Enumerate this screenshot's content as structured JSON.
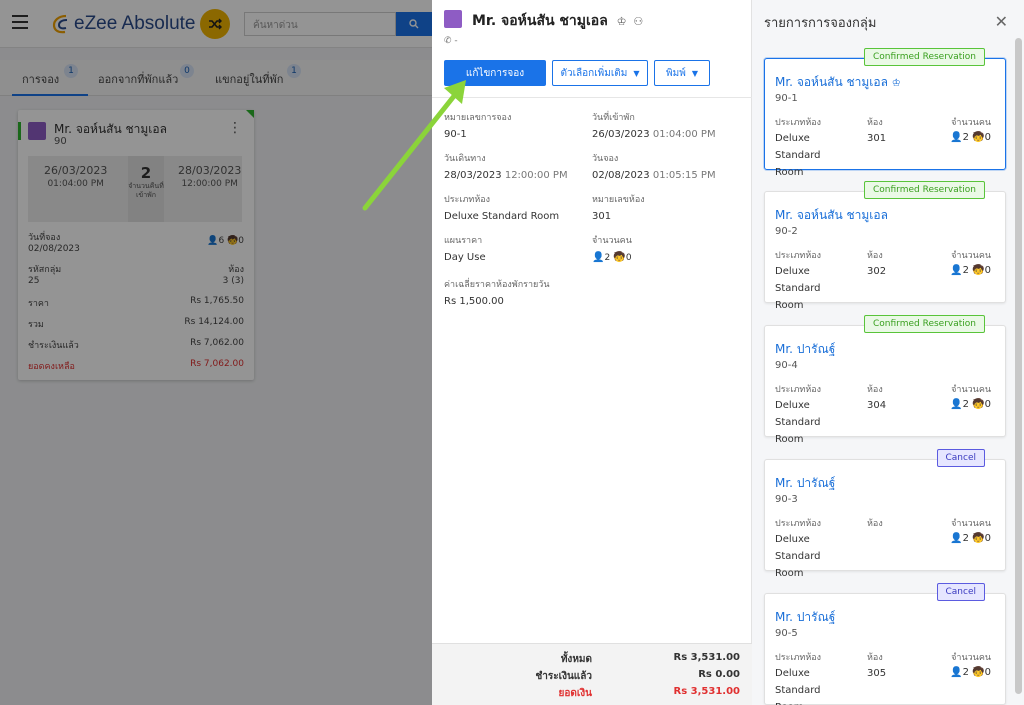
{
  "app": {
    "logo_text": "eZee Absolute",
    "search_placeholder": "ค้นหาด่วน"
  },
  "tabs": [
    {
      "label": "การจอง",
      "count": "1"
    },
    {
      "label": "ออกจากที่พักแล้ว",
      "count": "0"
    },
    {
      "label": "แขกอยู่ในที่พัก",
      "count": "1"
    }
  ],
  "res_card": {
    "guest": "Mr. จอห์นสัน ชามูเอล",
    "number": "90",
    "arrival_date": "26/03/2023",
    "arrival_time": "01:04:00 PM",
    "departure_date": "28/03/2023",
    "departure_time": "12:00:00 PM",
    "nights": "2",
    "nights_label": "จำนวนคืนที่เข้าพัก",
    "booking_label": "วันที่จอง",
    "booking_date": "02/08/2023",
    "adults": "6",
    "children": "0",
    "group_label": "รหัสกลุ่ม",
    "group_value": "25",
    "room_label": "ห้อง",
    "room_value": "3 (3)",
    "price_label": "ราคา",
    "price_value": "Rs 1,765.50",
    "total_label": "รวม",
    "total_value": "Rs 14,124.00",
    "paid_label": "ชำระเงินแล้ว",
    "paid_value": "Rs 7,062.00",
    "balance_label": "ยอดคงเหลือ",
    "balance_value": "Rs 7,062.00"
  },
  "detail": {
    "guest": "Mr. จอห์นสัน ชามูเอล",
    "phone": "-",
    "edit_button": "แก้ไขการจอง",
    "more_button": "ตัวเลือกเพิ่มเติม",
    "print_button": "พิมพ์",
    "res_no_label": "หมายเลขการจอง",
    "res_no": "90-1",
    "checkin_label": "วันที่เข้าพัก",
    "checkin_date": "26/03/2023",
    "checkin_time": "01:04:00 PM",
    "departure_label": "วันเดินทาง",
    "departure_date": "28/03/2023",
    "departure_time": "12:00:00 PM",
    "booking_label": "วันจอง",
    "booking_date": "02/08/2023",
    "booking_time": "01:05:15 PM",
    "room_type_label": "ประเภทห้อง",
    "room_type": "Deluxe Standard Room",
    "room_no_label": "หมายเลขห้อง",
    "room_no": "301",
    "rate_plan_label": "แผนราคา",
    "rate_plan": "Day Use",
    "pax_label": "จำนวนคน",
    "adults": "2",
    "children": "0",
    "avg_rate_label": "ค่าเฉลี่ยราคาห้องพักรายวัน",
    "avg_rate": "Rs 1,500.00",
    "total_label": "ทั้งหมด",
    "total": "Rs 3,531.00",
    "paid_label": "ชำระเงินแล้ว",
    "paid": "Rs 0.00",
    "balance_label": "ยอดเงิน",
    "balance": "Rs 3,531.00"
  },
  "group_list": {
    "title": "รายการการจองกลุ่ม",
    "room_type_label": "ประเภทห้อง",
    "room_label": "ห้อง",
    "pax_label": "จำนวนคน",
    "items": [
      {
        "status": "Confirmed Reservation",
        "guest": "Mr. จอห์นสัน ชามูเอล",
        "number": "90-1",
        "room_type_1": "Deluxe Standard",
        "room_type_2": "Room",
        "room": "301",
        "adults": "2",
        "children": "0"
      },
      {
        "status": "Confirmed Reservation",
        "guest": "Mr. จอห์นสัน ชามูเอล",
        "number": "90-2",
        "room_type_1": "Deluxe Standard",
        "room_type_2": "Room",
        "room": "302",
        "adults": "2",
        "children": "0"
      },
      {
        "status": "Confirmed Reservation",
        "guest": "Mr. ปารัณฐ์",
        "number": "90-4",
        "room_type_1": "Deluxe Standard",
        "room_type_2": "Room",
        "room": "304",
        "adults": "2",
        "children": "0"
      },
      {
        "status": "Cancel",
        "guest": "Mr. ปารัณฐ์",
        "number": "90-3",
        "room_type_1": "Deluxe Standard",
        "room_type_2": "Room",
        "room": "",
        "adults": "2",
        "children": "0"
      },
      {
        "status": "Cancel",
        "guest": "Mr. ปารัณฐ์",
        "number": "90-5",
        "room_type_1": "Deluxe Standard",
        "room_type_2": "Room",
        "room": "305",
        "adults": "2",
        "children": "0"
      }
    ]
  },
  "colors": {
    "primary": "#1a73e8",
    "confirmed": "#59c43a",
    "cancel": "#5b5be0",
    "balance_red": "#e03030",
    "arrow": "#8bd43a"
  }
}
